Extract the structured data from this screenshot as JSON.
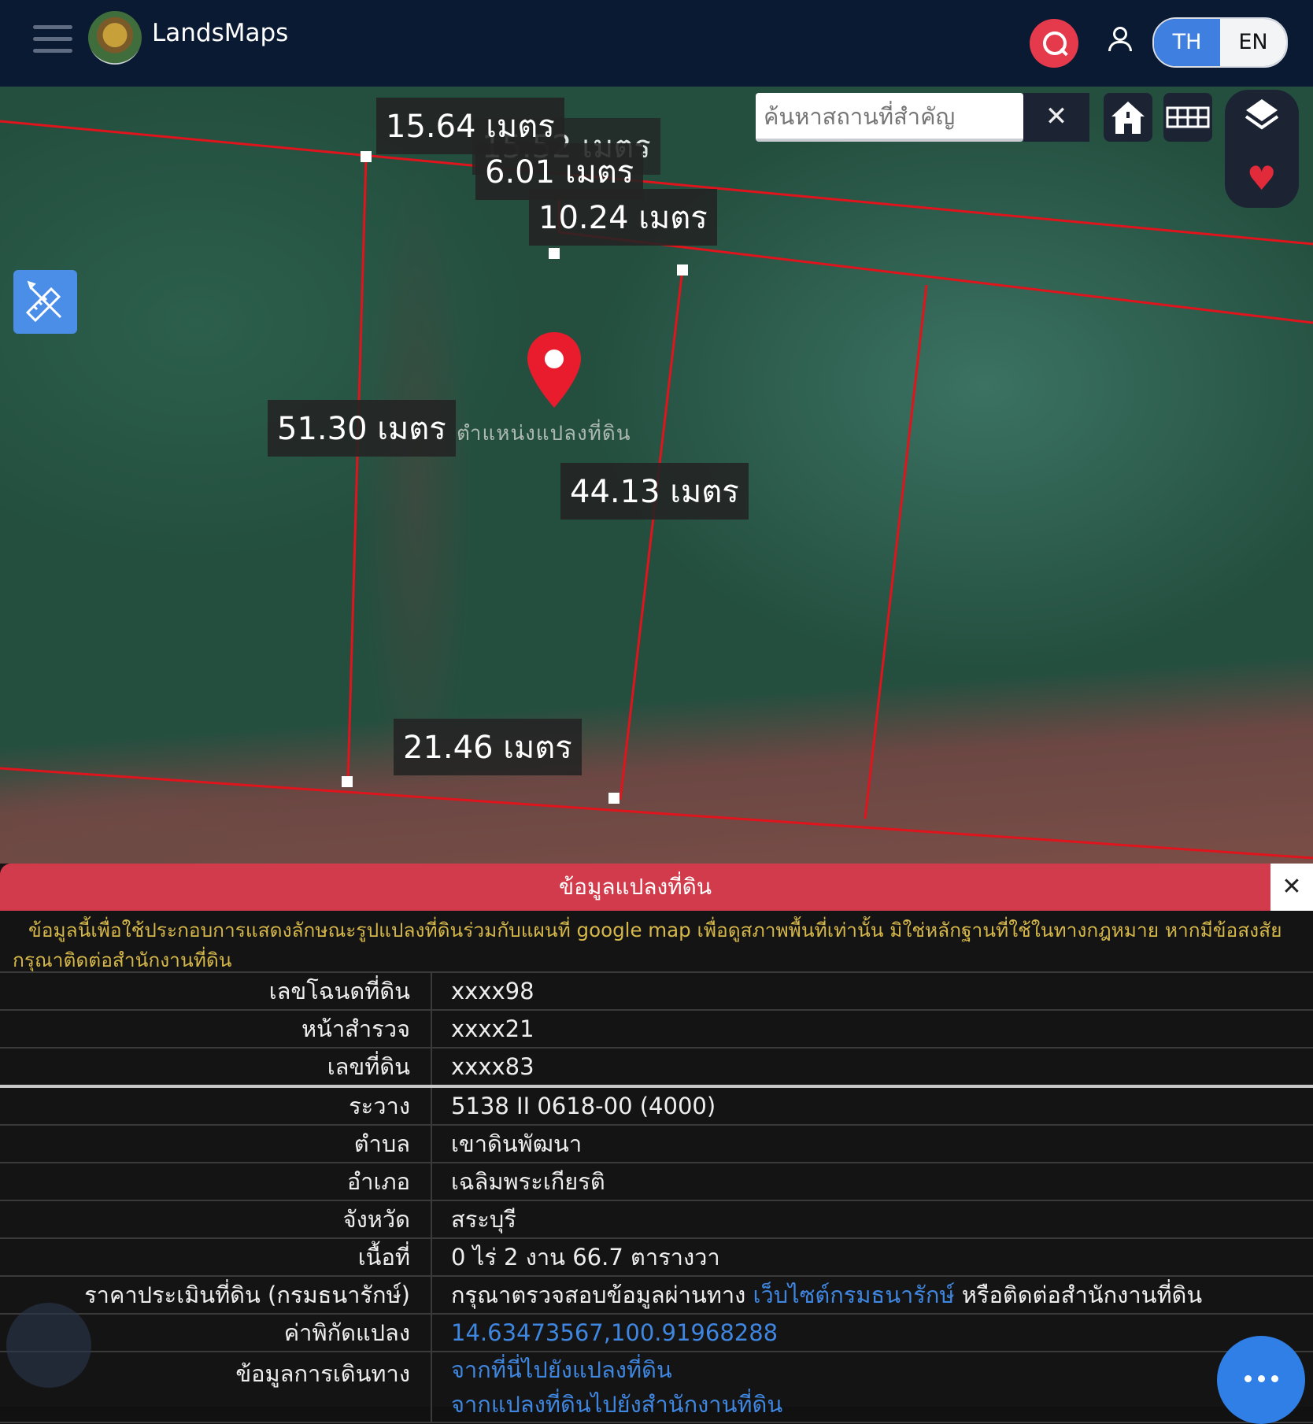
{
  "header": {
    "brand": "LandsMaps",
    "lang_th": "TH",
    "lang_en": "EN"
  },
  "map": {
    "search_placeholder": "ค้นหาสถานที่สำคัญ",
    "search_clear": "✕",
    "parcel_label": "ตำแหน่งแปลงที่ดิน",
    "dimensions": [
      "15.64 เมตร",
      "15.52 เมตร",
      "6.01 เมตร",
      "10.24 เมตร",
      "51.30 เมตร",
      "44.13 เมตร",
      "21.46 เมตร"
    ]
  },
  "panel": {
    "title": "ข้อมูลแปลงที่ดิน",
    "close": "✕",
    "disclaimer": "ข้อมูลนี้เพื่อใช้ประกอบการแสดงลักษณะรูปแปลงที่ดินร่วมกับแผนที่ google map เพื่อดูสภาพพื้นที่เท่านั้น มิใช่หลักฐานที่ใช้ในทางกฎหมาย หากมีข้อสงสัยกรุณาติดต่อสำนักงานที่ดิน",
    "rows": [
      {
        "label": "เลขโฉนดที่ดิน",
        "value": "xxxx98"
      },
      {
        "label": "หน้าสำรวจ",
        "value": "xxxx21"
      },
      {
        "label": "เลขที่ดิน",
        "value": "xxxx83"
      },
      {
        "label": "ระวาง",
        "value": "5138 II 0618-00 (4000)"
      },
      {
        "label": "ตำบล",
        "value": "เขาดินพัฒนา"
      },
      {
        "label": "อำเภอ",
        "value": "เฉลิมพระเกียรติ"
      },
      {
        "label": "จังหวัด",
        "value": "สระบุรี"
      },
      {
        "label": "เนื้อที่",
        "value": "0 ไร่ 2 งาน 66.7 ตารางวา"
      }
    ],
    "price": {
      "label": "ราคาประเมินที่ดิน (กรมธนารักษ์)",
      "text_before": "กรุณาตรวจสอบข้อมูลผ่านทาง",
      "link": "เว็บไซต์กรมธนารักษ์",
      "text_after": "หรือติดต่อสำนักงานที่ดิน"
    },
    "coords": {
      "label": "ค่าพิกัดแปลง",
      "value": "14.63473567,100.91968288"
    },
    "directions": {
      "label": "ข้อมูลการเดินทาง",
      "link1": "จากที่นี่ไปยังแปลงที่ดิน",
      "link2": "จากแปลงที่ดินไปยังสำนักงานที่ดิน"
    }
  },
  "icons": {
    "menu": "hamburger-icon",
    "search": "search-icon",
    "user": "user-icon",
    "home": "home-icon",
    "grid": "grid-icon",
    "layers": "layers-icon",
    "favorite": "heart-icon",
    "measure": "ruler-pencil-icon",
    "pin": "map-pin-icon",
    "chat": "more-dots-icon"
  },
  "colors": {
    "header_bg": "#0b1a33",
    "accent_red": "#e53a4b",
    "panel_header": "#d23b4b",
    "link": "#3f86e0",
    "disclaimer": "#d5b74a",
    "boundary": "#e0141c"
  }
}
